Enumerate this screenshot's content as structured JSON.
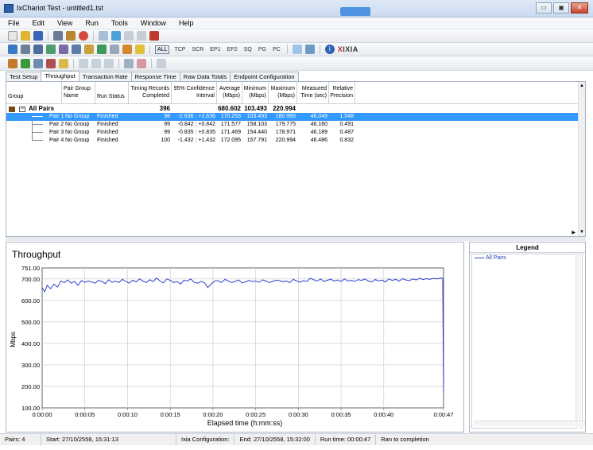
{
  "window": {
    "title": "IxChariot Test - untitled1.tst"
  },
  "menu": [
    "File",
    "Edit",
    "View",
    "Run",
    "Tools",
    "Window",
    "Help"
  ],
  "toolbar2": {
    "all_label": "ALL",
    "items": [
      "TCP",
      "SCR",
      "EP1",
      "EP2",
      "SQ",
      "PG",
      "PC"
    ],
    "brand": "IXIA",
    "brand_x": "X"
  },
  "tabs": [
    "Test Setup",
    "Throughput",
    "Transaction Rate",
    "Response Time",
    "Raw Data Totals",
    "Endpoint Configuration"
  ],
  "active_tab": "Throughput",
  "grid": {
    "columns": [
      {
        "label": "Group"
      },
      {
        "label": "Pair Group Name"
      },
      {
        "label": "Run Status"
      },
      {
        "label": "Timing Records Completed"
      },
      {
        "label": "95% Confidence Interval"
      },
      {
        "label": "Average (Mbps)"
      },
      {
        "label": "Minimum (Mbps)"
      },
      {
        "label": "Maximum (Mbps)"
      },
      {
        "label": "Measured Time (sec)"
      },
      {
        "label": "Relative Precision"
      }
    ],
    "all_pairs": {
      "name": "All Pairs",
      "records": "396",
      "average": "680.602",
      "minimum": "103.493",
      "maximum": "220.994"
    },
    "rows": [
      {
        "name": "Pair 1",
        "group": "No Group",
        "status": "Finished",
        "records": "98",
        "ci": "-2.636 : +2.636",
        "avg": "170.253",
        "min": "103.493",
        "max": "180.995",
        "time": "46.049",
        "rp": "1.548"
      },
      {
        "name": "Pair 2",
        "group": "No Group",
        "status": "Finished",
        "records": "99",
        "ci": "-0.842 : +0.842",
        "avg": "171.577",
        "min": "158.103",
        "max": "179.775",
        "time": "46.160",
        "rp": "0.491"
      },
      {
        "name": "Pair 3",
        "group": "No Group",
        "status": "Finished",
        "records": "99",
        "ci": "-0.835 : +0.835",
        "avg": "171.469",
        "min": "154.440",
        "max": "178.971",
        "time": "46.189",
        "rp": "0.487"
      },
      {
        "name": "Pair 4",
        "group": "No Group",
        "status": "Finished",
        "records": "100",
        "ci": "-1.432 : +1.432",
        "avg": "172.095",
        "min": "157.791",
        "max": "220.994",
        "time": "46.486",
        "rp": "0.832"
      }
    ]
  },
  "legend": {
    "title": "Legend",
    "items": [
      "All Pairs"
    ]
  },
  "statusbar": [
    "Pairs: 4",
    "Start: 27/10/2558, 15:31:13",
    "Ixia Configuration:",
    "End: 27/10/2558, 15:32:00",
    "Run time: 00:00:47",
    "Ran to completion"
  ],
  "chart_data": {
    "type": "line",
    "title": "Throughput",
    "xlabel": "Elapsed time (h:mm:ss)",
    "ylabel": "Mbps",
    "ylim": [
      100,
      751
    ],
    "yticks": [
      "751.00",
      "700.00",
      "600.00",
      "500.00",
      "400.00",
      "300.00",
      "200.00",
      "100.00"
    ],
    "ytick_values": [
      751,
      700,
      600,
      500,
      400,
      300,
      200,
      100
    ],
    "xlim": [
      0,
      47
    ],
    "xticks": [
      "0:00:00",
      "0:00:05",
      "0:00:10",
      "0:00:15",
      "0:00:20",
      "0:00:25",
      "0:00:30",
      "0:00:35",
      "0:00:40",
      "0:00:47"
    ],
    "xtick_values": [
      0,
      5,
      10,
      15,
      20,
      25,
      30,
      35,
      40,
      47
    ],
    "grid": true,
    "color": "#2b3fcf",
    "series": [
      {
        "name": "All Pairs",
        "x": [
          0,
          0.3,
          0.6,
          1,
          1.4,
          1.8,
          2.2,
          2.6,
          3,
          3.4,
          3.8,
          4.2,
          4.6,
          5,
          5.4,
          5.8,
          6.2,
          6.6,
          7,
          7.4,
          7.8,
          8.2,
          8.6,
          9,
          9.4,
          9.8,
          10.2,
          10.6,
          11,
          11.4,
          11.8,
          12.2,
          12.6,
          13,
          13.4,
          13.8,
          14.2,
          14.6,
          15,
          15.4,
          15.8,
          16.2,
          16.6,
          17,
          17.4,
          17.8,
          18.2,
          18.6,
          19,
          19.4,
          19.8,
          20.2,
          20.6,
          21,
          21.4,
          21.8,
          22.2,
          22.6,
          23,
          23.4,
          23.8,
          24.2,
          24.6,
          25,
          25.4,
          25.8,
          26.2,
          26.6,
          27,
          27.4,
          27.8,
          28.2,
          28.6,
          29,
          29.4,
          29.8,
          30.2,
          30.6,
          31,
          31.4,
          31.8,
          32.2,
          32.6,
          33,
          33.4,
          33.8,
          34.2,
          34.6,
          35,
          35.4,
          35.8,
          36.2,
          36.6,
          37,
          37.4,
          37.8,
          38.2,
          38.6,
          39,
          39.4,
          39.8,
          40.2,
          40.6,
          41,
          41.4,
          41.8,
          42.2,
          42.6,
          43,
          43.4,
          43.8,
          44.2,
          44.6,
          45,
          45.4,
          45.8,
          46.2,
          46.6,
          46.8,
          46.9,
          47
        ],
        "y": [
          660,
          640,
          670,
          655,
          675,
          662,
          690,
          683,
          695,
          680,
          688,
          670,
          692,
          684,
          690,
          686,
          680,
          693,
          688,
          678,
          696,
          684,
          690,
          683,
          698,
          688,
          680,
          694,
          686,
          700,
          690,
          683,
          696,
          688,
          704,
          690,
          681,
          700,
          693,
          683,
          688,
          676,
          694,
          690,
          700,
          684,
          680,
          688,
          683,
          660,
          676,
          690,
          692,
          683,
          698,
          690,
          683,
          688,
          695,
          682,
          686,
          693,
          688,
          690,
          684,
          696,
          690,
          683,
          688,
          694,
          692,
          687,
          690,
          683,
          698,
          690,
          685,
          692,
          688,
          703,
          696,
          690,
          700,
          688,
          694,
          698,
          690,
          695,
          688,
          700,
          690,
          694,
          688,
          697,
          693,
          700,
          690,
          686,
          697,
          691,
          694,
          686,
          700,
          693,
          698,
          690,
          701,
          695,
          692,
          700,
          695,
          703,
          697,
          701,
          698,
          703,
          700,
          703,
          704,
          702,
          180
        ]
      }
    ]
  }
}
